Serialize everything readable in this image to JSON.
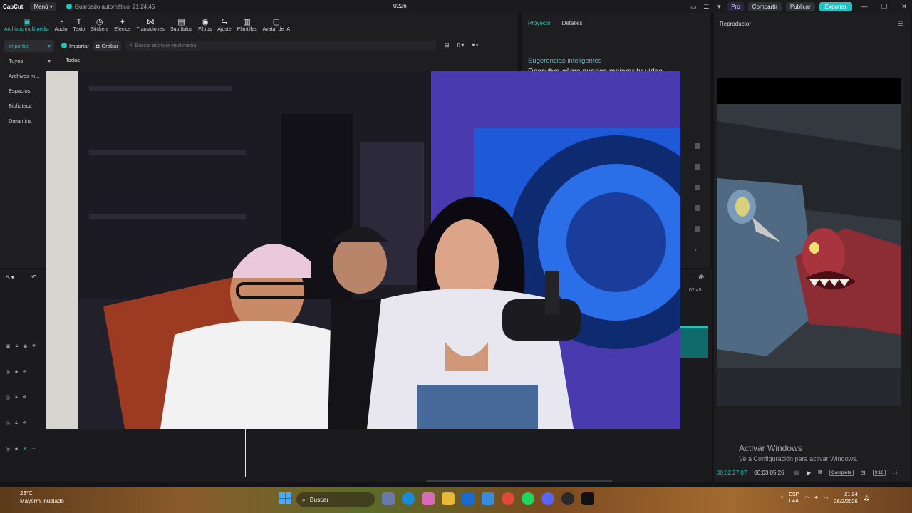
{
  "titlebar": {
    "logo": "CapCut",
    "menu": "Menú",
    "autosave": "Guardado automático: 21:24:45",
    "project_name": "0226",
    "pro": "Pro",
    "share": "Compartir",
    "publish": "Publicar",
    "export": "Exportar"
  },
  "toolbar": [
    {
      "label": "Archivos multimedia",
      "icon": "media-icon",
      "active": true
    },
    {
      "label": "Audio",
      "icon": "audio-icon"
    },
    {
      "label": "Texto",
      "icon": "text-icon"
    },
    {
      "label": "Stickers",
      "icon": "sticker-icon"
    },
    {
      "label": "Efectos",
      "icon": "effects-icon"
    },
    {
      "label": "Transiciones",
      "icon": "transition-icon"
    },
    {
      "label": "Subtítulos",
      "icon": "subtitles-icon"
    },
    {
      "label": "Filtros",
      "icon": "filter-icon"
    },
    {
      "label": "Ajuste",
      "icon": "adjust-icon"
    },
    {
      "label": "Plantillas",
      "icon": "templates-icon"
    },
    {
      "label": "Avatar de IA",
      "icon": "avatar-icon"
    }
  ],
  "sidenav": [
    "Importar",
    "Tuyos",
    "Archivos m...",
    "Espacios",
    "Biblioteca",
    "Dreamina"
  ],
  "media": {
    "import": "Importar",
    "record": "Grabar",
    "search_placeholder": "Buscar archivos multimedia",
    "filter_all": "Todos"
  },
  "project_panel": {
    "tab_project": "Proyecto",
    "tab_details": "Detalles",
    "suggest_title": "Sugerencias inteligentes",
    "suggest_sub": "Descubre cómo puedes mejorar tu video"
  },
  "player": {
    "title": "Reproductor",
    "current_time": "00:02:27:07",
    "total_time": "00:03:05:26",
    "full_label": "Completa",
    "ratio_label": "9:16"
  },
  "timeline": {
    "end_time": "02:45"
  },
  "watermark": {
    "line1": "Activar Windows",
    "line2": "Ve a Configuración para activar Windows."
  },
  "taskbar": {
    "temp": "23°C",
    "weather": "Mayorm. nublado",
    "search": "Buscar",
    "lang1": "ESP",
    "lang2": "LAA",
    "time": "21:24",
    "date": "26/2/2026"
  },
  "colors": {
    "accent": "#1fc3bc",
    "export_bg": "#1ec4c4"
  }
}
